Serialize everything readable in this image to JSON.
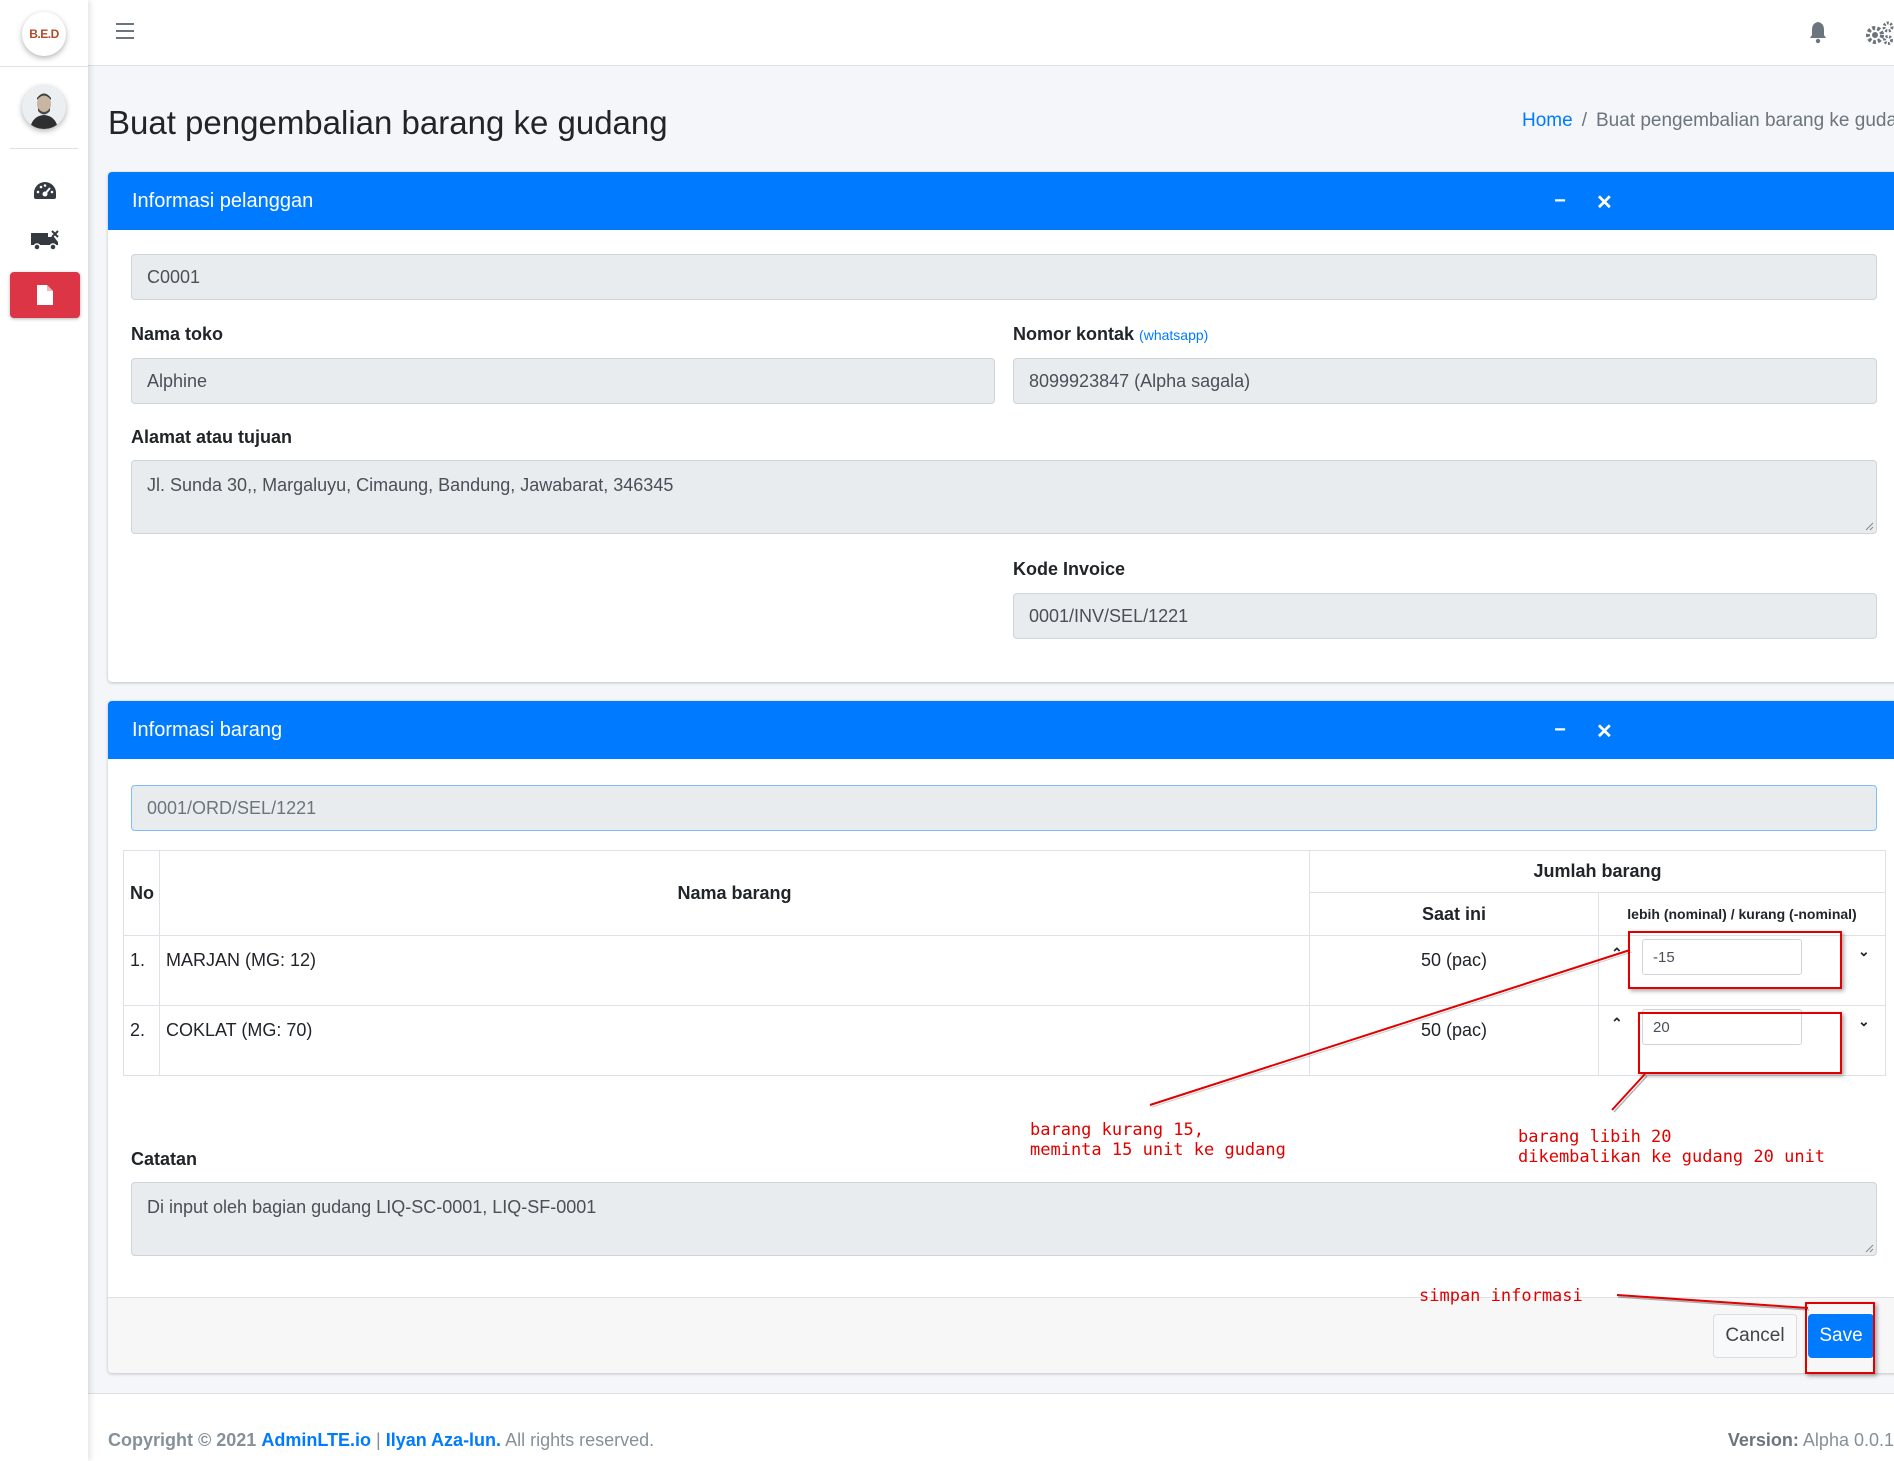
{
  "sidebar": {
    "logo_text": "B.E.D",
    "items": [
      {
        "icon": "tachometer-icon"
      },
      {
        "icon": "truck-icon"
      },
      {
        "icon": "file-icon",
        "active": true
      }
    ]
  },
  "header": {
    "title": "Buat pengembalian barang ke gudang",
    "breadcrumb_home": "Home",
    "breadcrumb_sep": "/",
    "breadcrumb_current": "Buat pengembalian barang ke gudang"
  },
  "customer_card": {
    "title": "Informasi pelanggan",
    "minimize": "−",
    "close": "✕",
    "customer_code": "C0001",
    "store_label": "Nama toko",
    "store_value": "Alphine",
    "contact_label": "Nomor kontak",
    "contact_hint": "(whatsapp)",
    "contact_value": "8099923847 (Alpha sagala)",
    "address_label": "Alamat atau tujuan",
    "address_value": "Jl. Sunda 30,, Margaluyu, Cimaung, Bandung, Jawabarat, 346345",
    "invoice_label": "Kode Invoice",
    "invoice_value": "0001/INV/SEL/1221"
  },
  "items_card": {
    "title": "Informasi barang",
    "minimize": "−",
    "close": "✕",
    "order_placeholder": "0001/ORD/SEL/1221",
    "table": {
      "col_no": "No",
      "col_name": "Nama barang",
      "col_group": "Jumlah barang",
      "col_current": "Saat ini",
      "col_adjust": "lebih (nominal) / kurang (-nominal)",
      "rows": [
        {
          "no": "1.",
          "name": "MARJAN (MG: 12)",
          "current": "50 (pac)",
          "adjust": "-15"
        },
        {
          "no": "2.",
          "name": "COKLAT (MG: 70)",
          "current": "50 (pac)",
          "adjust": "20"
        }
      ]
    },
    "notes_label": "Catatan",
    "notes_value": "Di input oleh bagian gudang LIQ-SC-0001, LIQ-SF-0001",
    "cancel_label": "Cancel",
    "save_label": "Save"
  },
  "annotations": {
    "note_less": "barang kurang 15,\nmeminta 15 unit ke gudang",
    "note_more": "barang libih 20\ndikembalikan ke gudang 20 unit",
    "note_save": "simpan informasi",
    "color": "#e00000"
  },
  "footer": {
    "copyright": "Copyright © 2021",
    "brand": "AdminLTE.io",
    "pipe": "|",
    "author": "Ilyan Aza-lun.",
    "rights": "All rights reserved.",
    "version_label": "Version:",
    "version_value": "Alpha 0.0.1"
  },
  "colors": {
    "primary": "#007bff",
    "danger": "#dc3545"
  }
}
